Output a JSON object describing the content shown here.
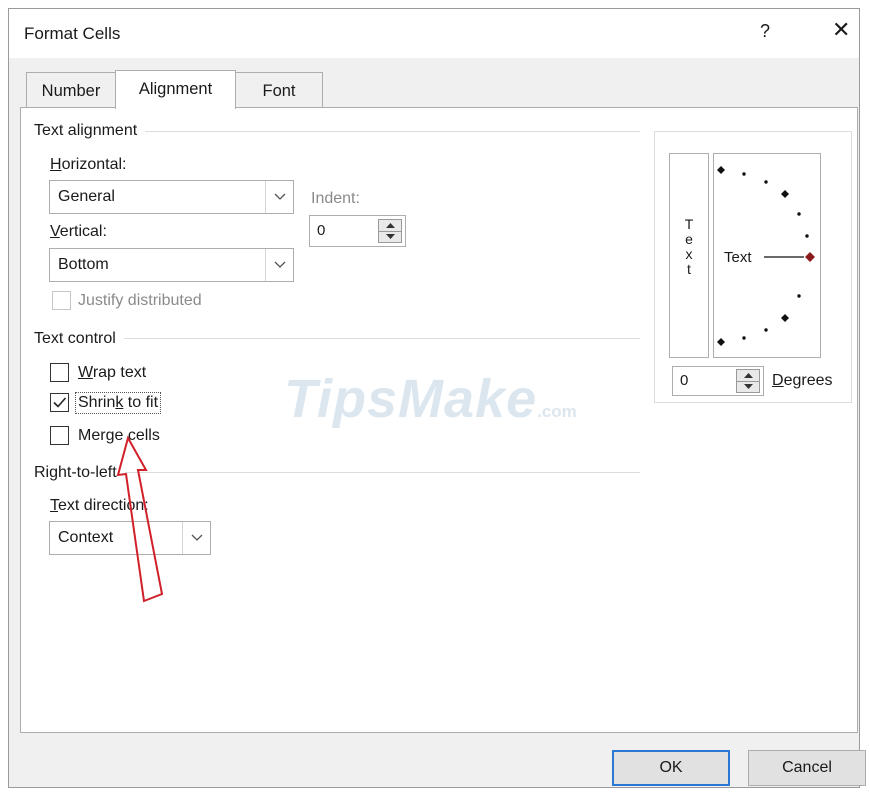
{
  "dialog": {
    "title": "Format Cells",
    "help_label": "?",
    "close_label": "✕"
  },
  "tabs": [
    {
      "label": "Number",
      "active": false
    },
    {
      "label": "Alignment",
      "active": true
    },
    {
      "label": "Font",
      "active": false
    }
  ],
  "text_alignment": {
    "group_label": "Text alignment",
    "horizontal": {
      "label_accel": "H",
      "label_rest": "orizontal:",
      "value": "General"
    },
    "indent": {
      "label": "Indent:",
      "value": "0"
    },
    "vertical": {
      "label_accel": "V",
      "label_rest": "ertical:",
      "value": "Bottom"
    },
    "justify_distributed": {
      "label": "Justify distributed",
      "checked": false,
      "enabled": false
    }
  },
  "text_control": {
    "group_label": "Text control",
    "wrap_text": {
      "label_accel": "W",
      "label_rest": "rap text",
      "checked": false
    },
    "shrink_to_fit": {
      "label_pre": "Shrin",
      "label_accel": "k",
      "label_rest": " to fit",
      "checked": true
    },
    "merge_cells": {
      "label_pre": "Mer",
      "label_accel": "g",
      "label_rest": "e cells",
      "checked": false
    }
  },
  "right_to_left": {
    "group_label": "Right-to-left",
    "text_direction": {
      "label_accel": "T",
      "label_rest": "ext direction:",
      "value": "Context"
    }
  },
  "orientation": {
    "vertical_text": [
      "T",
      "e",
      "x",
      "t"
    ],
    "dial_text": "Text",
    "degrees_value": "0",
    "degrees_accel": "D",
    "degrees_rest": "egrees"
  },
  "footer": {
    "ok_label": "OK",
    "cancel_label": "Cancel"
  },
  "watermark": {
    "main": "TipsMake",
    "suffix": ".com"
  },
  "colors": {
    "accent": "#2b78d4",
    "annotation_arrow": "#d0202a",
    "dial_marker": "#8b1a1a"
  }
}
